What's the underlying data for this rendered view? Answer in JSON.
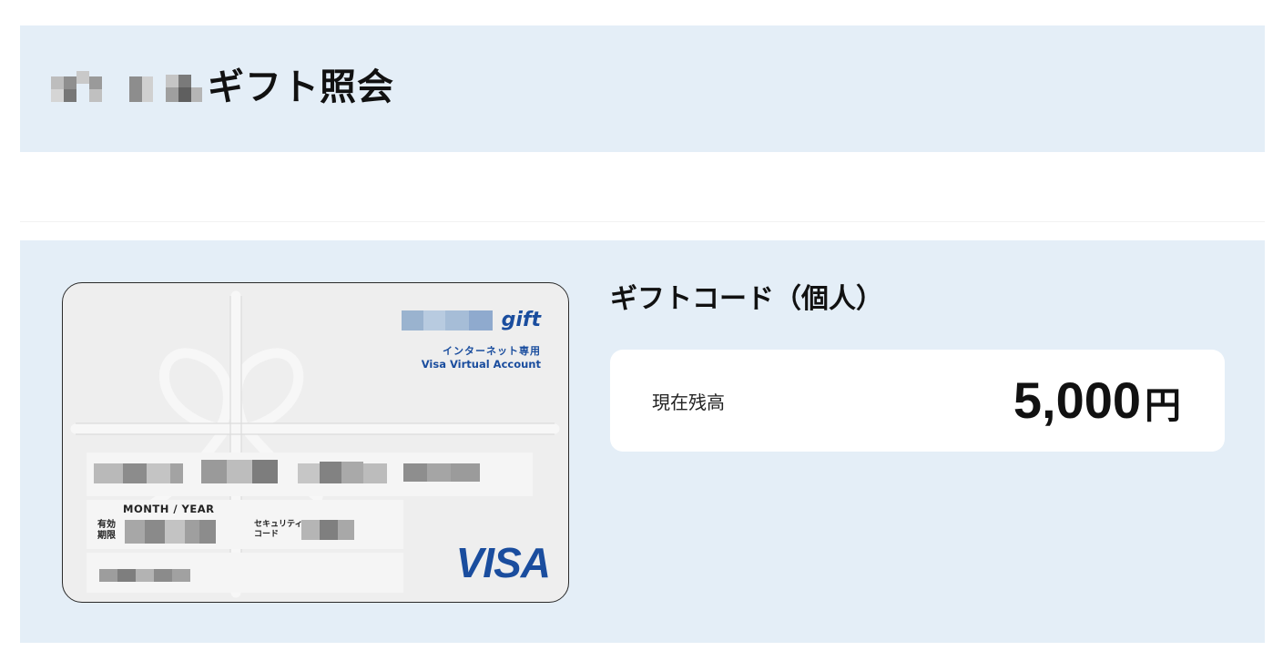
{
  "header": {
    "title": "ギフト照会"
  },
  "card": {
    "brand_suffix": "gift",
    "subtitle_jp": "インターネット専用",
    "subtitle_en": "Visa Virtual Account",
    "month_year_label": "MONTH / YEAR",
    "valid_label_line1": "有効",
    "valid_label_line2": "期限",
    "security_label_line1": "セキュリティ",
    "security_label_line2": "コード",
    "network_logo": "VISA"
  },
  "gift": {
    "title": "ギフトコード（個人）",
    "balance_label": "現在残高",
    "balance_amount": "5,000",
    "balance_unit": "円"
  },
  "colors": {
    "panel_bg": "#e4eef7",
    "visa_blue": "#1a4d9e"
  }
}
